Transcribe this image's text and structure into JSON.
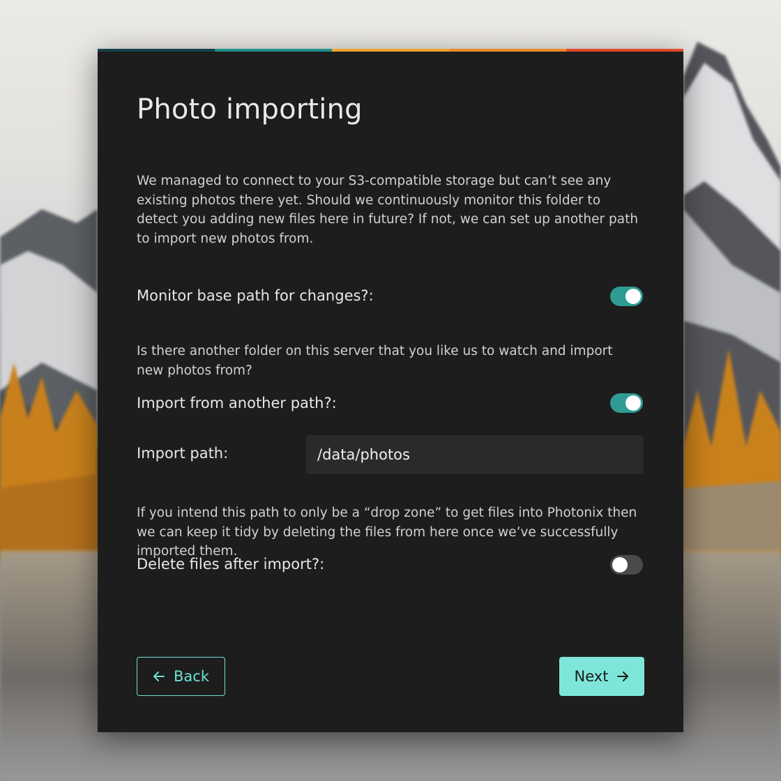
{
  "dialog": {
    "title": "Photo importing",
    "stripe_colors": [
      "#13414a",
      "#1d8f89",
      "#f0a52c",
      "#ec8a2a",
      "#e2492a"
    ],
    "intro": "We managed to connect to your S3-compatible storage but can’t see any existing photos there yet. Should we continuously monitor this folder to detect you adding new files here in future? If not, we can set up another path to import new photos from.",
    "monitor": {
      "label": "Monitor base path for changes?:",
      "enabled": true
    },
    "another_folder_text": "Is there another folder on this server that you like us to watch and import new photos from?",
    "import_another": {
      "label": "Import from another path?:",
      "enabled": true
    },
    "import_path": {
      "label": "Import path:",
      "value": "/data/photos"
    },
    "drop_zone_text": "If you intend this path to only be a “drop zone” to get files into Photonix then we can keep it tidy by deleting the files from here once we’ve successfully imported them.",
    "delete_after": {
      "label": "Delete files after import?:",
      "enabled": false
    }
  },
  "buttons": {
    "back_label": "Back",
    "next_label": "Next",
    "back_icon": "arrow-left-icon",
    "next_icon": "arrow-right-icon"
  },
  "colors": {
    "accent": "#2f9c94",
    "button_primary": "#7ee6d8",
    "panel_bg": "#1d1d1d"
  }
}
